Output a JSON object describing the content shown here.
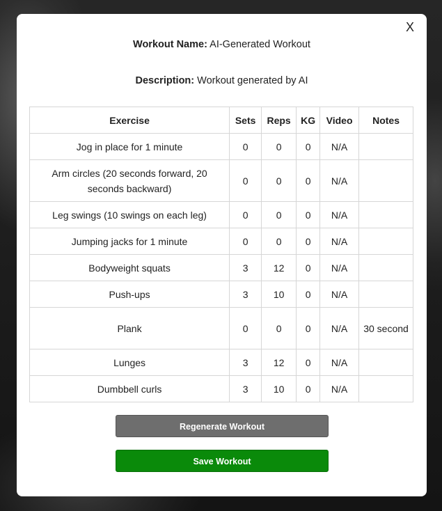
{
  "modal": {
    "close_label": "X",
    "workout_name_label": "Workout Name:",
    "workout_name_value": "AI-Generated Workout",
    "description_label": "Description:",
    "description_value": "Workout generated by AI"
  },
  "table": {
    "headers": [
      "Exercise",
      "Sets",
      "Reps",
      "KG",
      "Video",
      "Notes"
    ],
    "rows": [
      {
        "exercise": "Jog in place for 1 minute",
        "sets": "0",
        "reps": "0",
        "kg": "0",
        "video": "N/A",
        "notes": ""
      },
      {
        "exercise": "Arm circles (20 seconds forward, 20 seconds backward)",
        "sets": "0",
        "reps": "0",
        "kg": "0",
        "video": "N/A",
        "notes": ""
      },
      {
        "exercise": "Leg swings (10 swings on each leg)",
        "sets": "0",
        "reps": "0",
        "kg": "0",
        "video": "N/A",
        "notes": ""
      },
      {
        "exercise": "Jumping jacks for 1 minute",
        "sets": "0",
        "reps": "0",
        "kg": "0",
        "video": "N/A",
        "notes": ""
      },
      {
        "exercise": "Bodyweight squats",
        "sets": "3",
        "reps": "12",
        "kg": "0",
        "video": "N/A",
        "notes": ""
      },
      {
        "exercise": "Push-ups",
        "sets": "3",
        "reps": "10",
        "kg": "0",
        "video": "N/A",
        "notes": ""
      },
      {
        "exercise": "Plank",
        "sets": "0",
        "reps": "0",
        "kg": "0",
        "video": "N/A",
        "notes": "30 second"
      },
      {
        "exercise": "Lunges",
        "sets": "3",
        "reps": "12",
        "kg": "0",
        "video": "N/A",
        "notes": ""
      },
      {
        "exercise": "Dumbbell curls",
        "sets": "3",
        "reps": "10",
        "kg": "0",
        "video": "N/A",
        "notes": ""
      }
    ]
  },
  "buttons": {
    "regenerate_label": "Regenerate Workout",
    "save_label": "Save Workout"
  },
  "colors": {
    "save_button": "#0a8a0a",
    "regenerate_button": "#6e6e6e"
  }
}
